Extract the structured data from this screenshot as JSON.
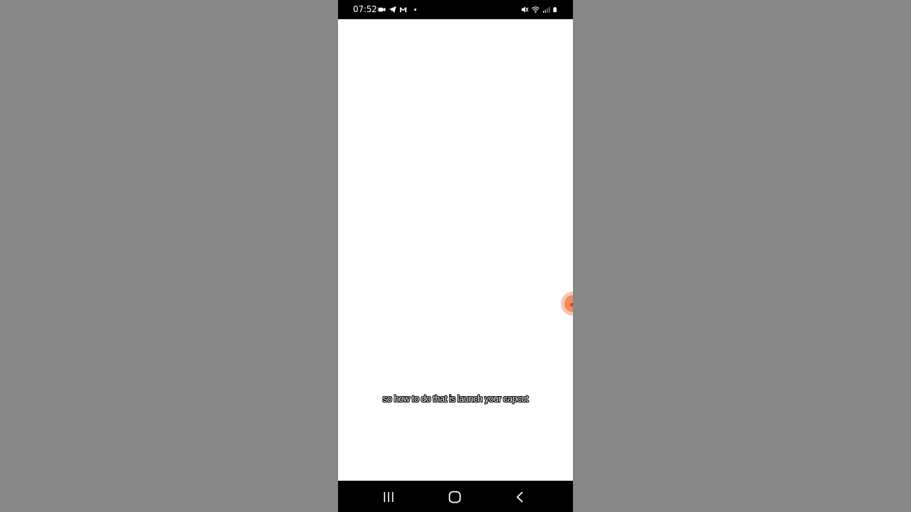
{
  "status_bar": {
    "time": "07:52",
    "left_icons": [
      "video-camera-icon",
      "telegram-icon",
      "gmail-icon",
      "notification-dot-icon"
    ],
    "right_icons": [
      "mute-icon",
      "wifi-icon",
      "signal-icon",
      "battery-icon"
    ]
  },
  "video": {
    "caption": "so how to do that is launch your capcut"
  },
  "floating_bubble": {
    "icon": "screen-recorder-bubble-icon",
    "color": "#f08a60"
  },
  "nav_bar": {
    "buttons": [
      "recents-icon",
      "home-icon",
      "back-icon"
    ]
  },
  "colors": {
    "background": "#878787",
    "status_bar": "#000000",
    "content": "#ffffff",
    "nav_bar": "#000000"
  }
}
